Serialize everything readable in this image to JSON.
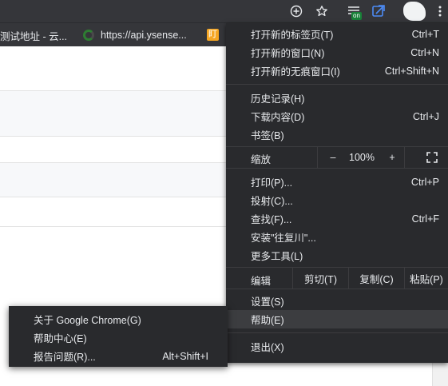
{
  "toolbar": {
    "extension_badge": "on"
  },
  "bookmarks": {
    "items": [
      {
        "label": "测试地址 - 云..."
      },
      {
        "label": "https://api.ysense..."
      }
    ],
    "overflow_glyph": "盯"
  },
  "menu": {
    "new_tab": {
      "label": "打开新的标签页(T)",
      "shortcut": "Ctrl+T"
    },
    "new_window": {
      "label": "打开新的窗口(N)",
      "shortcut": "Ctrl+N"
    },
    "new_incognito": {
      "label": "打开新的无痕窗口(I)",
      "shortcut": "Ctrl+Shift+N"
    },
    "history": {
      "label": "历史记录(H)"
    },
    "downloads": {
      "label": "下载内容(D)",
      "shortcut": "Ctrl+J"
    },
    "bookmarks": {
      "label": "书签(B)"
    },
    "zoom": {
      "label": "缩放",
      "minus": "–",
      "value": "100%",
      "plus": "+"
    },
    "print": {
      "label": "打印(P)...",
      "shortcut": "Ctrl+P"
    },
    "cast": {
      "label": "投射(C)..."
    },
    "find": {
      "label": "查找(F)...",
      "shortcut": "Ctrl+F"
    },
    "install": {
      "label": "安装\"往复川\"..."
    },
    "more_tools": {
      "label": "更多工具(L)"
    },
    "edit": {
      "label": "编辑",
      "cut": "剪切(T)",
      "copy": "复制(C)",
      "paste": "粘贴(P)"
    },
    "settings": {
      "label": "设置(S)"
    },
    "help": {
      "label": "帮助(E)"
    },
    "exit": {
      "label": "退出(X)"
    }
  },
  "submenu": {
    "about": {
      "label": "关于 Google Chrome(G)"
    },
    "help_center": {
      "label": "帮助中心(E)"
    },
    "report_issue": {
      "label": "报告问题(R)...",
      "shortcut": "Alt+Shift+I"
    }
  }
}
